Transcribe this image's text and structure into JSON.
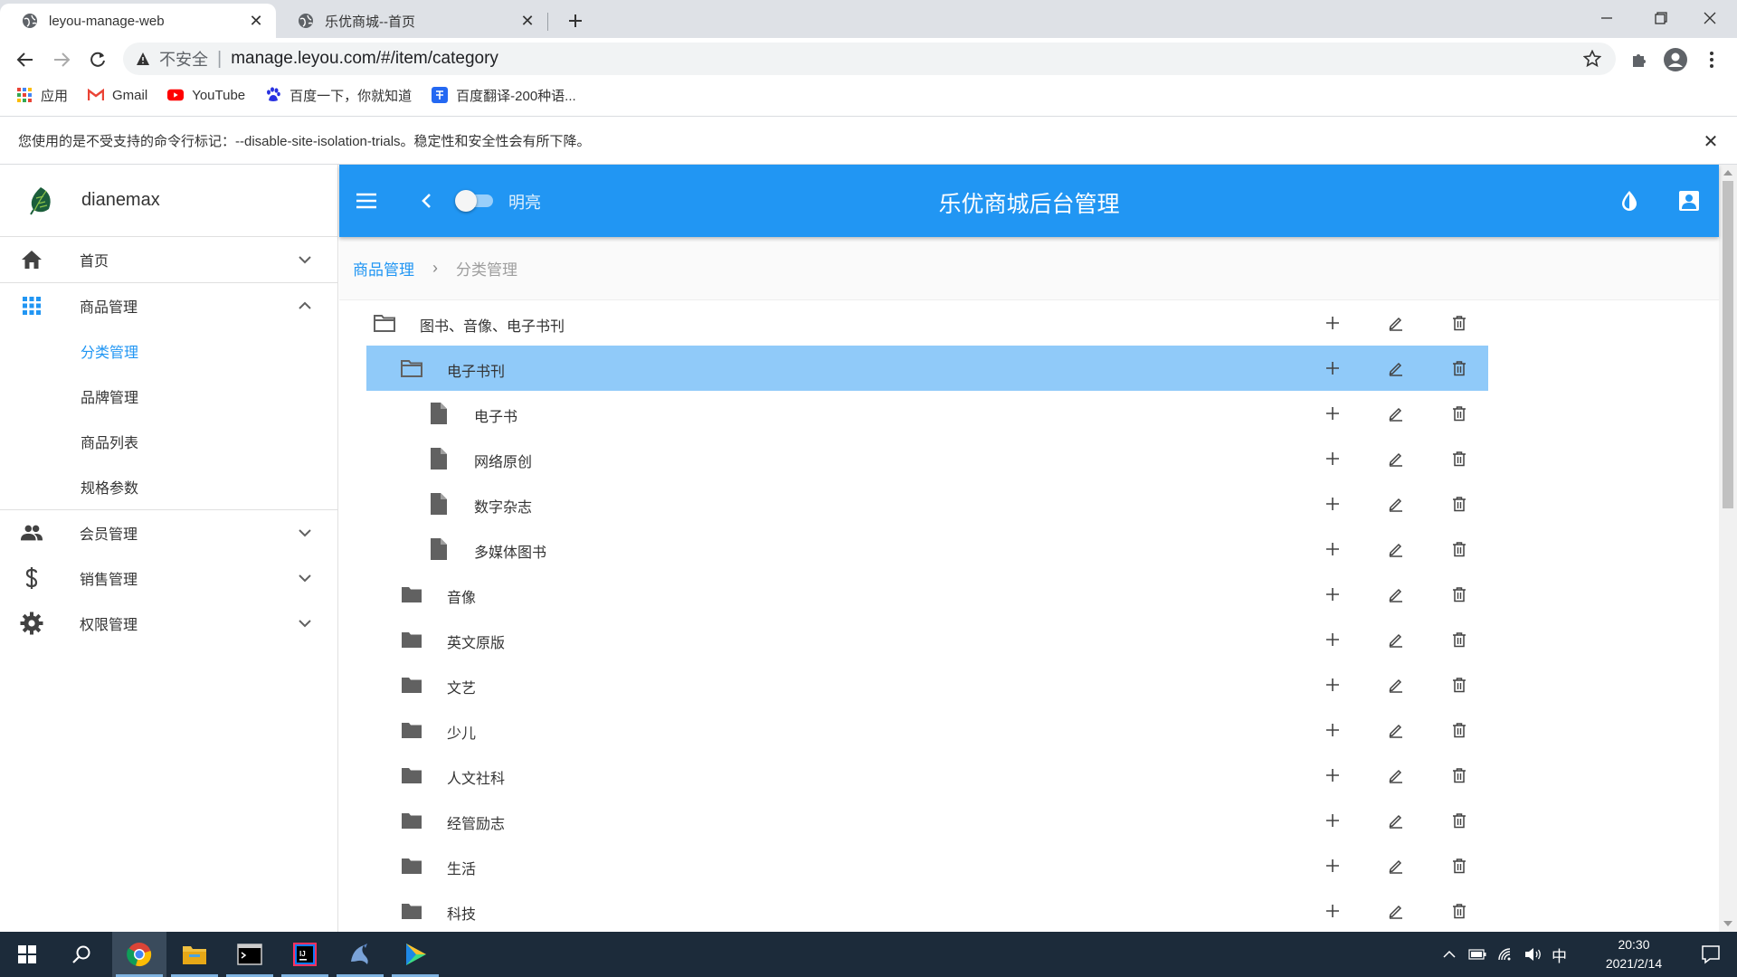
{
  "browser": {
    "tabs": [
      {
        "title": "leyou-manage-web"
      },
      {
        "title": "乐优商城--首页"
      }
    ],
    "address": {
      "security_label": "不安全",
      "url": "manage.leyou.com/#/item/category"
    },
    "bookmarks": [
      {
        "label": "应用",
        "icon": "apps-grid-icon"
      },
      {
        "label": "Gmail",
        "icon": "gmail-icon"
      },
      {
        "label": "YouTube",
        "icon": "youtube-icon"
      },
      {
        "label": "百度一下，你就知道",
        "icon": "baidu-paw-icon"
      },
      {
        "label": "百度翻译-200种语...",
        "icon": "baidu-translate-icon"
      }
    ],
    "infobar": "您使用的是不受支持的命令行标记：--disable-site-isolation-trials。稳定性和安全性会有所下降。",
    "infobar_close": "✕"
  },
  "sidebar": {
    "username": "dianemax",
    "menu": [
      {
        "label": "首页",
        "icon": "home-icon",
        "expanded": false
      },
      {
        "label": "商品管理",
        "icon": "apps-icon",
        "expanded": true,
        "children": [
          {
            "label": "分类管理",
            "active": true
          },
          {
            "label": "品牌管理"
          },
          {
            "label": "商品列表"
          },
          {
            "label": "规格参数"
          }
        ]
      },
      {
        "label": "会员管理",
        "icon": "people-icon",
        "expanded": false
      },
      {
        "label": "销售管理",
        "icon": "dollar-icon",
        "expanded": false
      },
      {
        "label": "权限管理",
        "icon": "gear-icon",
        "expanded": false
      }
    ]
  },
  "appbar": {
    "title": "乐优商城后台管理",
    "switch_label": "明亮",
    "switch_on": false
  },
  "breadcrumb": {
    "parent": "商品管理",
    "separator": "›",
    "current": "分类管理"
  },
  "tree": [
    {
      "label": "图书、音像、电子书刊",
      "level": 0,
      "type": "folder-open"
    },
    {
      "label": "电子书刊",
      "level": 1,
      "type": "folder-open",
      "selected": true
    },
    {
      "label": "电子书",
      "level": 2,
      "type": "file"
    },
    {
      "label": "网络原创",
      "level": 2,
      "type": "file"
    },
    {
      "label": "数字杂志",
      "level": 2,
      "type": "file"
    },
    {
      "label": "多媒体图书",
      "level": 2,
      "type": "file"
    },
    {
      "label": "音像",
      "level": 1,
      "type": "folder"
    },
    {
      "label": "英文原版",
      "level": 1,
      "type": "folder"
    },
    {
      "label": "文艺",
      "level": 1,
      "type": "folder"
    },
    {
      "label": "少儿",
      "level": 1,
      "type": "folder"
    },
    {
      "label": "人文社科",
      "level": 1,
      "type": "folder"
    },
    {
      "label": "经管励志",
      "level": 1,
      "type": "folder"
    },
    {
      "label": "生活",
      "level": 1,
      "type": "folder"
    },
    {
      "label": "科技",
      "level": 1,
      "type": "folder"
    }
  ],
  "taskbar": {
    "apps": [
      "windows-start-icon",
      "search-icon",
      "chrome-icon",
      "file-explorer-icon",
      "terminal-icon",
      "intellij-icon",
      "dolphin-icon",
      "media-player-icon"
    ],
    "ime": "中",
    "time": "20:30",
    "date": "2021/2/14"
  },
  "colors": {
    "primary": "#2196f3",
    "selected_row": "#90caf9",
    "taskbar": "#1c2b3a"
  }
}
